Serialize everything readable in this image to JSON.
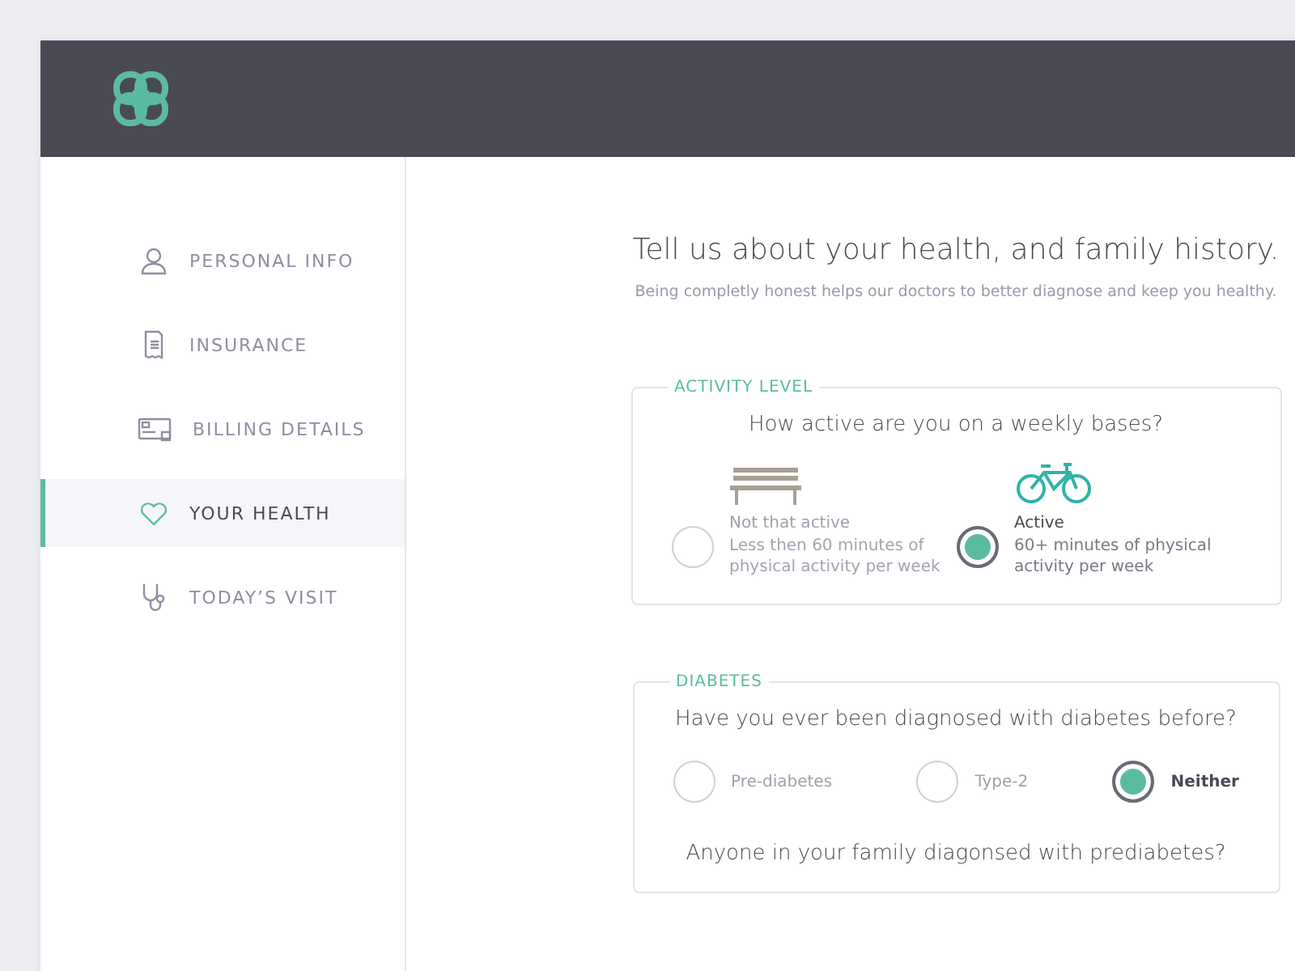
{
  "sidebar": {
    "items": [
      {
        "label": "PERSONAL INFO",
        "selected": false
      },
      {
        "label": "INSURANCE",
        "selected": false
      },
      {
        "label": "BILLING DETAILS",
        "selected": false
      },
      {
        "label": "YOUR HEALTH",
        "selected": true
      },
      {
        "label": "TODAY’S VISIT",
        "selected": false
      }
    ]
  },
  "main": {
    "title": "Tell us about your health, and family history.",
    "subtitle": "Being completly honest helps our doctors to better diagnose and keep you healthy.",
    "sections": [
      {
        "legend": "ACTIVITY LEVEL",
        "kind": "illustrated",
        "question": "How active are you on a weekly bases?",
        "options": [
          {
            "label": "Not that active",
            "description": "Less then 60 minutes of physical activity per week",
            "selected": false
          },
          {
            "label": "Active",
            "description": "60+ minutes of physical activity per week",
            "selected": true
          }
        ]
      },
      {
        "legend": "DIABETES",
        "kind": "inline",
        "question": "Have you ever been diagnosed with diabetes before?",
        "options": [
          {
            "label": "Pre-diabetes",
            "selected": false
          },
          {
            "label": "Type-2",
            "selected": false
          },
          {
            "label": "Neither",
            "selected": true
          }
        ],
        "follow_up": "Anyone in your family diagonsed with prediabetes?"
      }
    ]
  }
}
